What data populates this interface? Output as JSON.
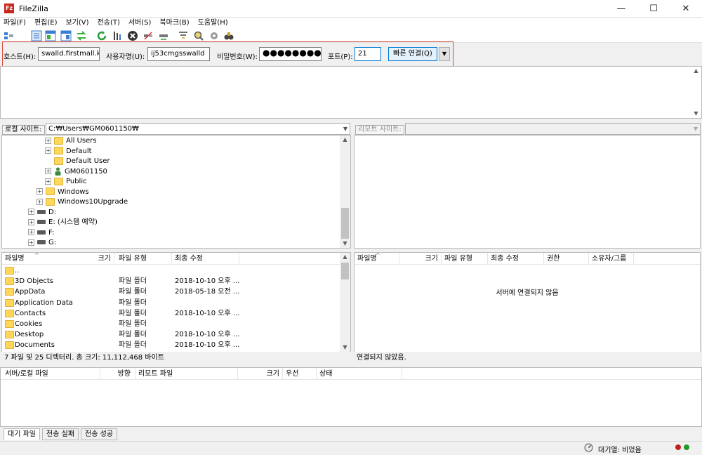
{
  "window": {
    "title": "FileZilla",
    "app_icon_text": "Fz",
    "minimize": "—",
    "maximize": "☐",
    "close": "✕"
  },
  "menu": [
    "파일(F)",
    "편집(E)",
    "보기(V)",
    "전송(T)",
    "서버(S)",
    "북마크(B)",
    "도움말(H)"
  ],
  "toolbar": {
    "icons": [
      "site-manager-icon",
      "toggle-log-icon",
      "toggle-local-tree-icon",
      "toggle-remote-tree-icon",
      "transfer-queue-icon",
      "refresh-icon",
      "process-queue-icon",
      "cancel-icon",
      "disconnect-icon",
      "reconnect-icon",
      "filter-icon",
      "compare-icon",
      "sync-browse-icon",
      "search-icon"
    ]
  },
  "quickconnect": {
    "host_label": "호스트(H):",
    "host_value": "swalld.firstmall.kr",
    "user_label": "사용자명(U):",
    "user_value": "ij53cmgsswalld",
    "pass_label": "비밀번호(W):",
    "pass_value": "●●●●●●●●",
    "port_label": "포트(P):",
    "port_value": "21",
    "connect_label": "빠른 연결(Q)",
    "dropdown": "▼"
  },
  "local": {
    "site_label": "로컬 사이트:",
    "path": "C:₩Users₩GM0601150₩",
    "tree": [
      {
        "label": "All Users",
        "indent": 5,
        "icon": "folder",
        "expander": "+"
      },
      {
        "label": "Default",
        "indent": 5,
        "icon": "folder",
        "expander": "+"
      },
      {
        "label": "Default User",
        "indent": 5,
        "icon": "folder",
        "expander": ""
      },
      {
        "label": "GM0601150",
        "indent": 5,
        "icon": "user",
        "expander": "+"
      },
      {
        "label": "Public",
        "indent": 5,
        "icon": "folder",
        "expander": "+"
      },
      {
        "label": "Windows",
        "indent": 4,
        "icon": "folder",
        "expander": "+"
      },
      {
        "label": "Windows10Upgrade",
        "indent": 4,
        "icon": "folder",
        "expander": "+"
      },
      {
        "label": "D:",
        "indent": 3,
        "icon": "drive",
        "expander": "+"
      },
      {
        "label": "E: (시스템 예약)",
        "indent": 3,
        "icon": "drive",
        "expander": "+"
      },
      {
        "label": "F:",
        "indent": 3,
        "icon": "drive",
        "expander": "+"
      },
      {
        "label": "G:",
        "indent": 3,
        "icon": "drive",
        "expander": "+"
      }
    ],
    "columns": [
      "파일명",
      "크기",
      "파일 유형",
      "최종 수정"
    ],
    "files": [
      {
        "name": "..",
        "size": "",
        "type": "",
        "modified": ""
      },
      {
        "name": "3D Objects",
        "size": "",
        "type": "파일 폴더",
        "modified": "2018-10-10 오후 ..."
      },
      {
        "name": "AppData",
        "size": "",
        "type": "파일 폴더",
        "modified": "2018-05-18 오전 ..."
      },
      {
        "name": "Application Data",
        "size": "",
        "type": "파일 폴더",
        "modified": ""
      },
      {
        "name": "Contacts",
        "size": "",
        "type": "파일 폴더",
        "modified": "2018-10-10 오후 ..."
      },
      {
        "name": "Cookies",
        "size": "",
        "type": "파일 폴더",
        "modified": ""
      },
      {
        "name": "Desktop",
        "size": "",
        "type": "파일 폴더",
        "modified": "2018-10-10 오후 ..."
      },
      {
        "name": "Documents",
        "size": "",
        "type": "파일 폴더",
        "modified": "2018-10-10 오후 ..."
      }
    ],
    "status": "7 파일 및 25 디렉터리. 총 크기: 11,112,468 바이트"
  },
  "remote": {
    "site_label": "리모트 사이트:",
    "path": "",
    "columns": [
      "파일명",
      "크기",
      "파일 유형",
      "최종 수정",
      "권한",
      "소유자/그룹"
    ],
    "empty_message": "서버에 연결되지 않음",
    "status": "연결되지 않았음."
  },
  "queue": {
    "columns": [
      "서버/로컬 파일",
      "방향",
      "리모트 파일",
      "크기",
      "우선",
      "상태"
    ],
    "tabs": [
      "대기 파일",
      "전송 실패",
      "전송 성공"
    ]
  },
  "statusbar": {
    "queue_text": "대기열: 비었음"
  },
  "colors": {
    "highlight": "#d34b3b",
    "accent": "#0078d7",
    "led_red": "#c0201e",
    "led_green": "#1e9a28"
  }
}
